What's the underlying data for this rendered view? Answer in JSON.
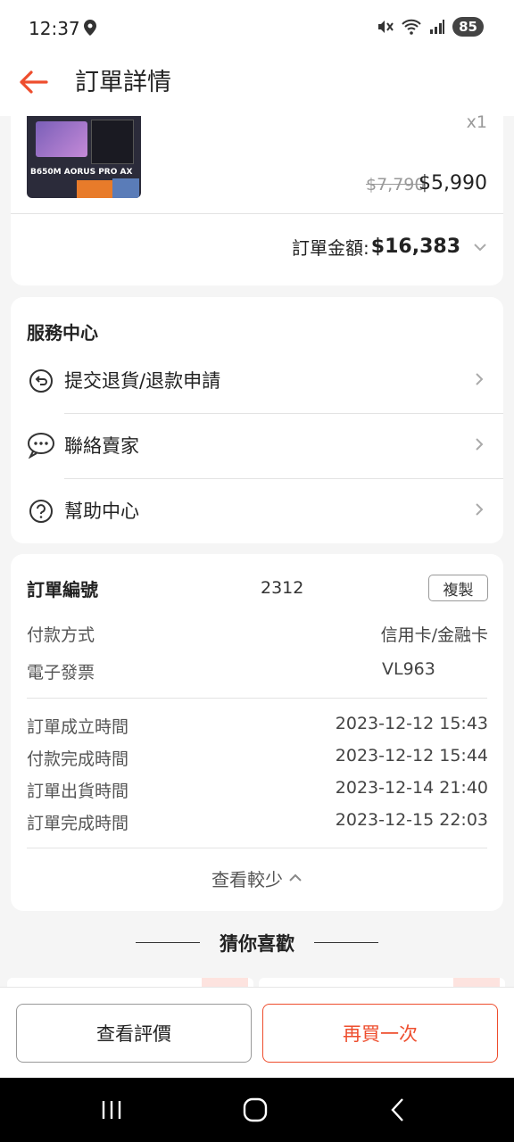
{
  "status_bar": {
    "time": "12:37",
    "battery": "85"
  },
  "header": {
    "title": "訂單詳情"
  },
  "product": {
    "image_label": "B650M AORUS PRO AX",
    "quantity": "x1",
    "original_price": "$7,790",
    "price": "$5,990"
  },
  "order_total": {
    "label": "訂單金額: ",
    "amount": "$16,383"
  },
  "service_center": {
    "title": "服務中心",
    "items": [
      {
        "label": "提交退貨/退款申請",
        "icon": "return-icon"
      },
      {
        "label": "聯絡賣家",
        "icon": "chat-icon"
      },
      {
        "label": "幫助中心",
        "icon": "help-icon"
      }
    ]
  },
  "order_info": {
    "order_no_label": "訂單編號",
    "order_no_value": "2312",
    "copy_label": "複製",
    "payment_label": "付款方式",
    "payment_value": "信用卡/金融卡",
    "invoice_label": "電子發票",
    "invoice_value": "VL963",
    "times": [
      {
        "label": "訂單成立時間",
        "value": "2023-12-12 15:43"
      },
      {
        "label": "付款完成時間",
        "value": "2023-12-12 15:44"
      },
      {
        "label": "訂單出貨時間",
        "value": "2023-12-14 21:40"
      },
      {
        "label": "訂單完成時間",
        "value": "2023-12-15 22:03"
      }
    ],
    "collapse_label": "查看較少"
  },
  "recommend": {
    "title": "猜你喜歡"
  },
  "actions": {
    "review_label": "查看評價",
    "rebuy_label": "再買一次"
  },
  "colors": {
    "accent": "#ee4d2d",
    "text": "#222222",
    "muted": "#555555"
  }
}
